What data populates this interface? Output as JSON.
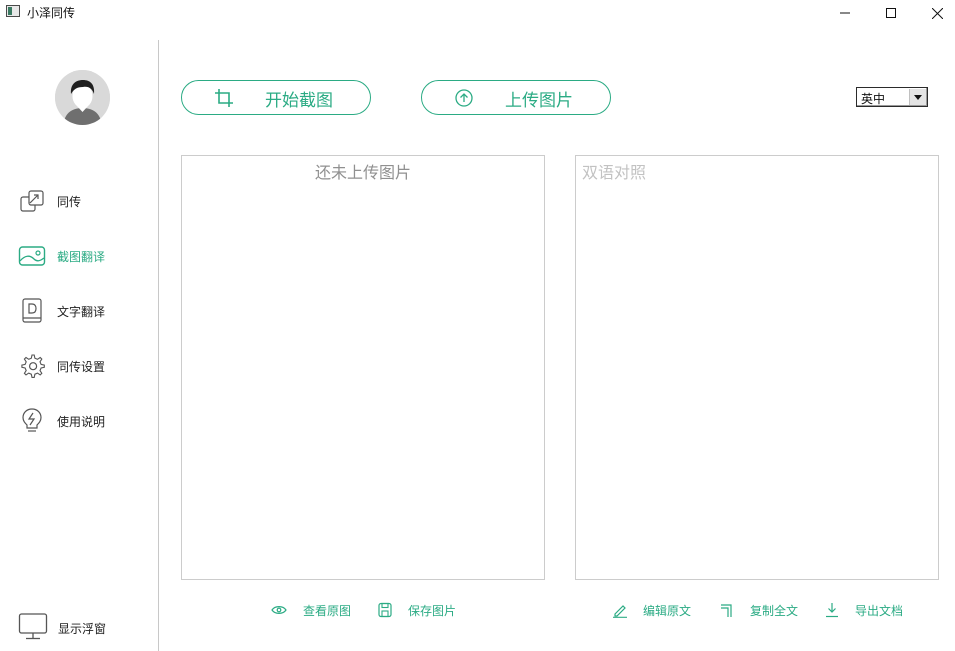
{
  "window": {
    "title": "小泽同传",
    "minimize_glyph": "—",
    "maximize_glyph": "☐",
    "close_glyph": "✕"
  },
  "sidebar": {
    "items": [
      {
        "label": "同传",
        "icon": "swap-window-icon",
        "active": false
      },
      {
        "label": "截图翻译",
        "icon": "image-icon",
        "active": true
      },
      {
        "label": "文字翻译",
        "icon": "document-d-icon",
        "active": false
      },
      {
        "label": "同传设置",
        "icon": "gear-icon",
        "active": false
      },
      {
        "label": "使用说明",
        "icon": "lightbulb-icon",
        "active": false
      }
    ],
    "float_window_label": "显示浮窗"
  },
  "toolbar": {
    "start_capture_label": "开始截图",
    "upload_image_label": "上传图片",
    "language_selected": "英中"
  },
  "panels": {
    "left_placeholder": "还未上传图片",
    "right_placeholder": "双语对照"
  },
  "left_actions": {
    "view_original_label": "查看原图",
    "save_image_label": "保存图片"
  },
  "right_actions": {
    "edit_source_label": "编辑原文",
    "copy_all_label": "复制全文",
    "export_doc_label": "导出文档"
  },
  "colors": {
    "accent": "#2bab84",
    "text": "#222222",
    "border": "#cccccc"
  }
}
